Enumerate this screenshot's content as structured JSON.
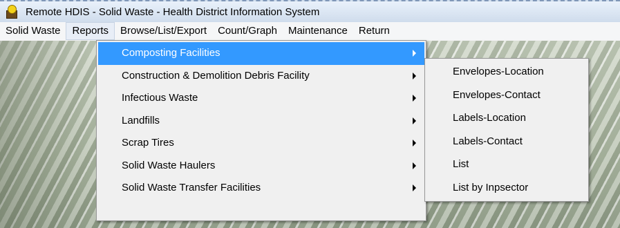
{
  "window": {
    "title": "Remote HDIS - Solid Waste - Health District Information System",
    "icon": "hdis-app-icon"
  },
  "menubar": {
    "items": [
      {
        "label": "Solid Waste"
      },
      {
        "label": "Reports",
        "active": true
      },
      {
        "label": "Browse/List/Export"
      },
      {
        "label": "Count/Graph"
      },
      {
        "label": "Maintenance"
      },
      {
        "label": "Return"
      }
    ]
  },
  "reports_menu": {
    "items": [
      {
        "label": "Composting Facilities",
        "selected": true,
        "has_submenu": true
      },
      {
        "label": "Construction & Demolition Debris Facility",
        "has_submenu": true
      },
      {
        "label": "Infectious Waste",
        "has_submenu": true
      },
      {
        "label": "Landfills",
        "has_submenu": true
      },
      {
        "label": "Scrap Tires",
        "has_submenu": true
      },
      {
        "label": "Solid Waste Haulers",
        "has_submenu": true
      },
      {
        "label": "Solid Waste Transfer Facilities",
        "has_submenu": true
      }
    ]
  },
  "composting_submenu": {
    "items": [
      {
        "label": "Envelopes-Location"
      },
      {
        "label": "Envelopes-Contact"
      },
      {
        "label": "Labels-Location"
      },
      {
        "label": "Labels-Contact"
      },
      {
        "label": "List"
      },
      {
        "label": "List by Inpsector"
      }
    ]
  },
  "colors": {
    "selection": "#3399ff",
    "menu_background": "#f0f0f0",
    "titlebar": "#cfdcec"
  }
}
